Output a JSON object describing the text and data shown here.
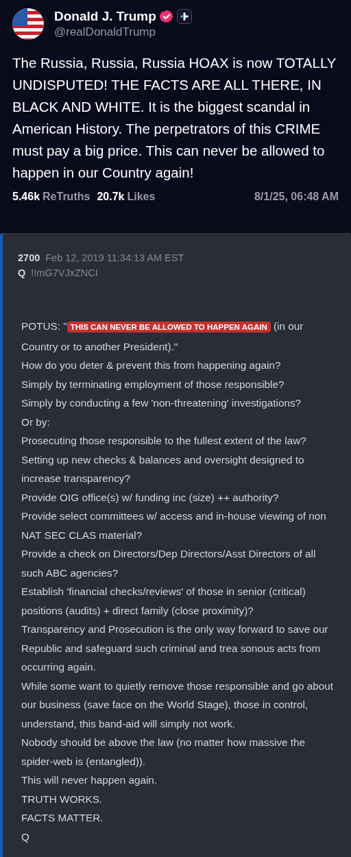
{
  "author": {
    "name": "Donald J. Trump",
    "handle": "@realDonaldTrump",
    "verified": true
  },
  "post": {
    "text": "The Russia, Russia, Russia HOAX is now TOTALLY UNDISPUTED! THE FACTS ARE ALL THERE, IN BLACK AND WHITE. It is the biggest scandal in American History. The perpetrators of this CRIME must pay a big price. This can never be allowed to happen in our Country again!"
  },
  "stats": {
    "retruths_count": "5.46k",
    "retruths_label": "ReTruths",
    "likes_count": "20.7k",
    "likes_label": "Likes",
    "timestamp": "8/1/25, 06:48 AM"
  },
  "embed": {
    "number": "2700",
    "date": "Feb 12, 2019 11:34:13 AM EST",
    "name": "Q",
    "tripcode": "!!mG7VJxZNCI",
    "lines": [
      {
        "kind": "highlight",
        "before": "POTUS: \"",
        "highlight": "THIS CAN NEVER BE ALLOWED TO HAPPEN AGAIN",
        "after": " (in our Country or to another President).\""
      },
      {
        "kind": "plain",
        "text": "How do you deter & prevent this from happening again?"
      },
      {
        "kind": "plain",
        "text": "Simply by terminating employment of those responsible?"
      },
      {
        "kind": "plain",
        "text": "Simply by conducting a few 'non-threatening' investigations?"
      },
      {
        "kind": "plain",
        "text": "Or by:"
      },
      {
        "kind": "plain",
        "text": "Prosecuting those responsible to the fullest extent of the law?"
      },
      {
        "kind": "plain",
        "text": "Setting up new checks & balances and oversight designed to increase transparency?"
      },
      {
        "kind": "plain",
        "text": "Provide OIG office(s) w/ funding inc (size) ++ authority?"
      },
      {
        "kind": "plain",
        "text": "Provide select committees w/ access and in-house viewing of non NAT SEC CLAS material?"
      },
      {
        "kind": "plain",
        "text": "Provide a check on Directors/Dep Directors/Asst Directors of all such ABC agencies?"
      },
      {
        "kind": "plain",
        "text": "Establish 'financial checks/reviews' of those in senior (critical) positions (audits) + direct family (close proximity)?"
      },
      {
        "kind": "plain",
        "text": "Transparency and Prosecution is the only way forward to save our Republic and safeguard such criminal and trea sonous acts from occurring again."
      },
      {
        "kind": "plain",
        "text": "While some want to quietly remove those responsible and go about our business (save face on the World Stage), those in control, understand, this band-aid will simply not work."
      },
      {
        "kind": "plain",
        "text": "Nobody should be above the law (no matter how massive the spider-web is (entangled))."
      },
      {
        "kind": "plain",
        "text": "This will never happen again."
      },
      {
        "kind": "plain",
        "text": "TRUTH WORKS."
      },
      {
        "kind": "plain",
        "text": "FACTS MATTER."
      },
      {
        "kind": "plain",
        "text": "Q"
      }
    ]
  }
}
